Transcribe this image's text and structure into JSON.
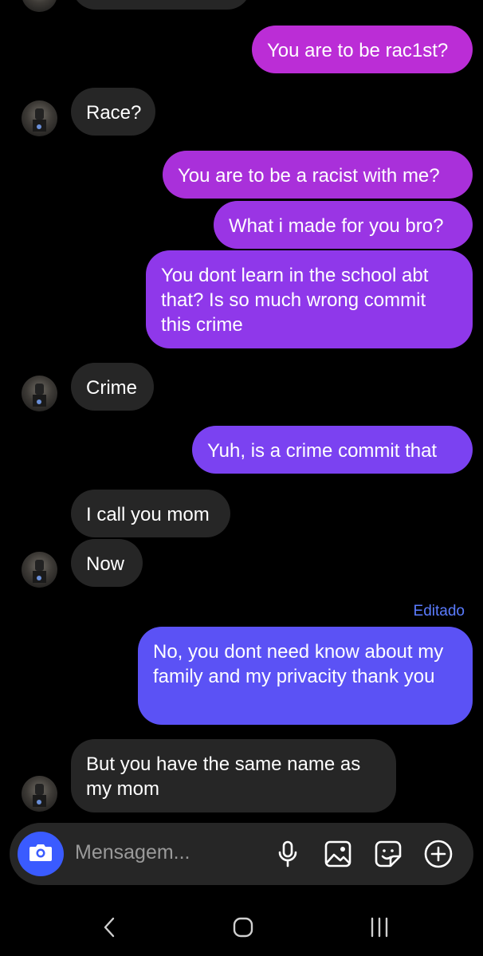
{
  "messages": [
    {
      "from": "other",
      "text": ""
    },
    {
      "from": "me",
      "text": "You are to be rac1st?"
    },
    {
      "from": "other",
      "text": "Race?"
    },
    {
      "from": "me",
      "text": "You are to be a racist with me?"
    },
    {
      "from": "me",
      "text": "What i made for you bro?"
    },
    {
      "from": "me",
      "text": "You dont learn in the school abt that? Is so much wrong commit this crime"
    },
    {
      "from": "other",
      "text": "Crime"
    },
    {
      "from": "me",
      "text": "Yuh, is a crime commit that"
    },
    {
      "from": "other",
      "text": "I call you mom"
    },
    {
      "from": "other",
      "text": "Now"
    },
    {
      "from": "me",
      "text": "No, you dont need know about my family and my privacity thank you"
    },
    {
      "from": "other",
      "text": "But you have the same name as my mom"
    }
  ],
  "edited_label": "Editado",
  "composer": {
    "placeholder": "Mensagem...",
    "icons": [
      "camera-icon",
      "microphone-icon",
      "image-icon",
      "sticker-icon",
      "plus-icon"
    ]
  },
  "nav": {
    "icons": [
      "back-icon",
      "home-icon",
      "recents-icon"
    ]
  },
  "colors": {
    "background": "#000000",
    "incoming_bubble": "#262626",
    "outgoing_magenta": "#b72fd8",
    "outgoing_violet": "#8b3cf0",
    "outgoing_blue": "#5b52f5",
    "accent": "#3a5bff",
    "edited": "#5b7cff"
  }
}
